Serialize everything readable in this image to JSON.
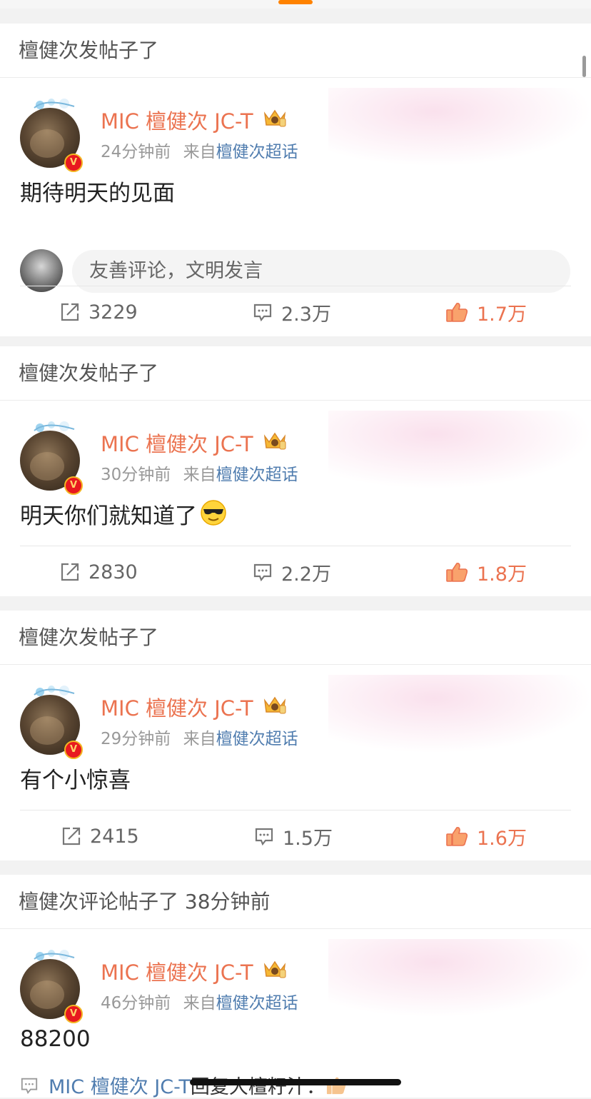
{
  "colors": {
    "accent": "#ff8200",
    "username": "#eb7350",
    "link": "#507daf",
    "like": "#eb7350"
  },
  "posts": [
    {
      "header": "檀健次发帖子了",
      "author": "MIC 檀健次 JC-T",
      "time": "24分钟前",
      "source_prefix": "来自",
      "source": "檀健次超话",
      "text": "期待明天的见面",
      "comment_placeholder": "友善评论，文明发言",
      "reposts": "3229",
      "comments": "2.3万",
      "likes": "1.7万"
    },
    {
      "header": "檀健次发帖子了",
      "author": "MIC 檀健次 JC-T",
      "time": "30分钟前",
      "source_prefix": "来自",
      "source": "檀健次超话",
      "text": "明天你们就知道了",
      "emoji": "sunglasses-emoji",
      "reposts": "2830",
      "comments": "2.2万",
      "likes": "1.8万"
    },
    {
      "header": "檀健次发帖子了",
      "author": "MIC 檀健次 JC-T",
      "time": "29分钟前",
      "source_prefix": "来自",
      "source": "檀健次超话",
      "text": "有个小惊喜",
      "reposts": "2415",
      "comments": "1.5万",
      "likes": "1.6万"
    },
    {
      "header": "檀健次评论帖子了 38分钟前",
      "author": "MIC 檀健次 JC-T",
      "time": "46分钟前",
      "source_prefix": "来自",
      "source": "檀健次超话",
      "text": "88200",
      "reply_author": "MIC 檀健次 JC-T",
      "reply_text": "回复大檀籽汁："
    }
  ]
}
